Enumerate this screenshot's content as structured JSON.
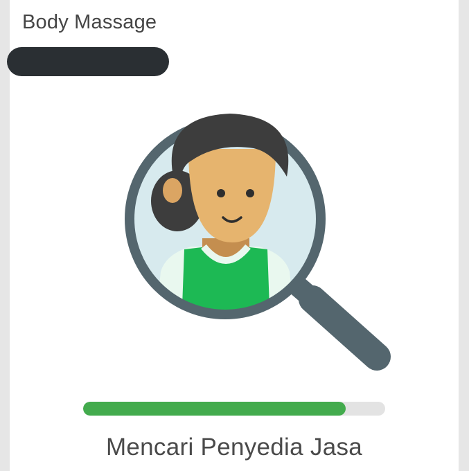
{
  "order": {
    "service_name": "Body Massage"
  },
  "search": {
    "progress_percent": 87,
    "status_text": "Mencari Penyedia Jasa",
    "illustration_icon": "magnifier-provider-icon"
  },
  "colors": {
    "progress_fill": "#43ab4d",
    "progress_track": "#e3e3e3",
    "magnifier_frame": "#54666e",
    "lens_background": "#d7eaee",
    "uniform_green": "#1db954",
    "skin": "#e6b46e",
    "hair": "#3d3d3d"
  }
}
